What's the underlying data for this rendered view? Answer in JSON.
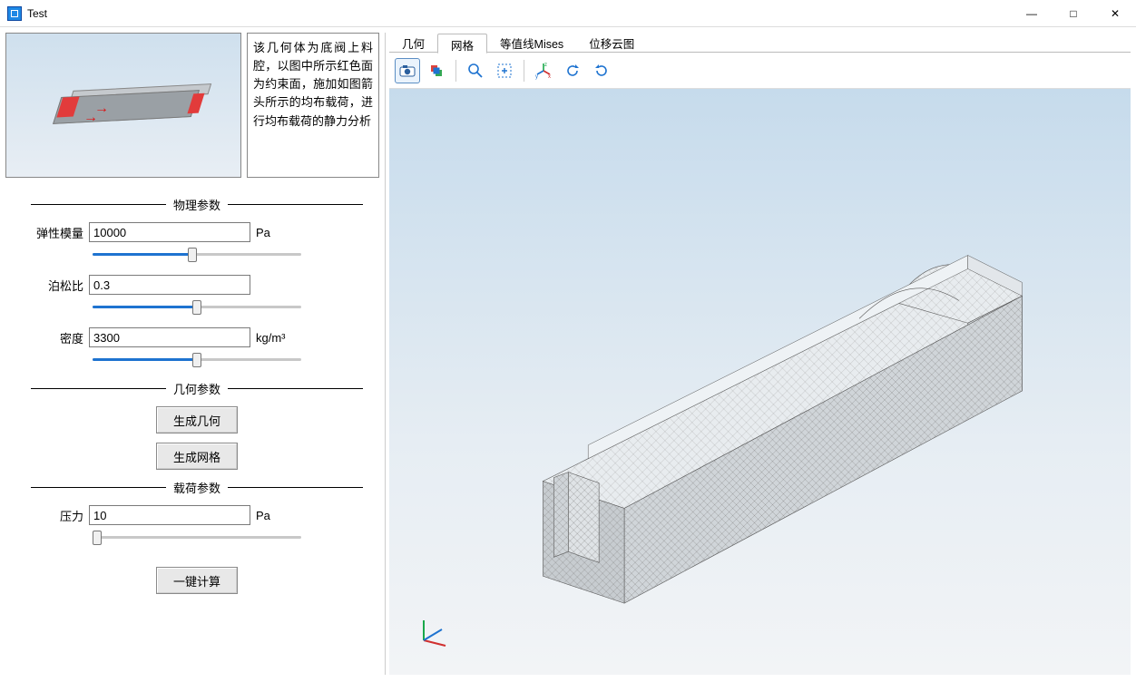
{
  "window": {
    "title": "Test"
  },
  "thumb": {
    "description": "该几何体为底阀上料腔，以图中所示红色面为约束面，施加如图箭头所示的均布载荷，进行均布载荷的静力分析"
  },
  "sections": {
    "physical_title": "物理参数",
    "geometry_title": "几何参数",
    "load_title": "载荷参数"
  },
  "fields": {
    "young": {
      "label": "弹性模量",
      "value": "10000",
      "unit": "Pa",
      "slider_pct": 48
    },
    "poisson": {
      "label": "泊松比",
      "value": "0.3",
      "unit": "",
      "slider_pct": 50
    },
    "density": {
      "label": "密度",
      "value": "3300",
      "unit": "kg/m³",
      "slider_pct": 50
    },
    "pressure": {
      "label": "压力",
      "value": "10",
      "unit": "Pa",
      "slider_pct": 2
    }
  },
  "buttons": {
    "gen_geom": "生成几何",
    "gen_mesh": "生成网格",
    "one_click": "一键计算"
  },
  "tabs": [
    "几何",
    "网格",
    "等值线Mises",
    "位移云图"
  ],
  "active_tab": 1,
  "toolbar_icons": [
    "camera-icon",
    "box-color-icon",
    "zoom-icon",
    "fit-icon",
    "axes-icon",
    "rotate-ccw-icon",
    "rotate-cw-icon"
  ]
}
